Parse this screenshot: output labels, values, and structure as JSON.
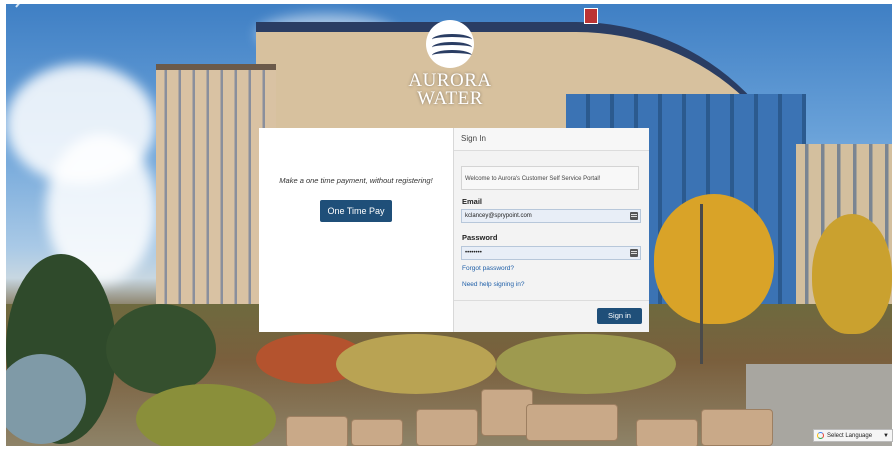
{
  "brand": {
    "line1": "AURORA",
    "line2": "WATER"
  },
  "one_time": {
    "message": "Make a one time payment, without registering!",
    "button_label": "One Time Pay"
  },
  "signin": {
    "header": "Sign In",
    "welcome": "Welcome to Aurora's Customer Self Service Portal!",
    "email_label": "Email",
    "email_value": "kclancey@sprypoint.com",
    "password_label": "Password",
    "password_value": "••••••••",
    "forgot_link": "Forgot password?",
    "help_link": "Need help signing in?",
    "button_label": "Sign in"
  },
  "language": {
    "label": "Select Language",
    "caret": "▼"
  },
  "colors": {
    "primary_button": "#1f4f79",
    "link": "#1f5fa8"
  }
}
